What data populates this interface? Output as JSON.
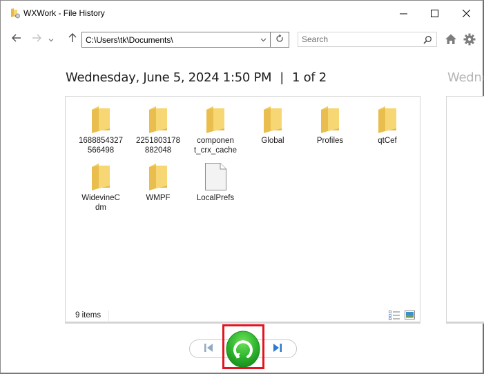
{
  "window": {
    "title": "WXWork - File History",
    "app_icon": "file-history-folder-icon",
    "controls": {
      "minimize": "minimize-icon",
      "maximize": "maximize-icon",
      "close": "close-icon"
    }
  },
  "nav": {
    "back": "back-arrow-icon",
    "forward": "forward-arrow-icon",
    "recent": "chevron-down-icon",
    "up": "up-arrow-icon",
    "address_value": "C:\\Users\\tk\\Documents\\",
    "refresh": "refresh-icon",
    "search_placeholder": "Search",
    "search_value": "",
    "home": "home-icon",
    "settings": "gear-icon"
  },
  "snapshot": {
    "date": "Wednesday, June 5, 2024 1:50 PM",
    "separator": "|",
    "position": "1 of 2",
    "next_date_partial": "Wednesday"
  },
  "files": [
    {
      "name": "1688854327566498",
      "label_lines": [
        "1688854327",
        "566498"
      ],
      "type": "folder"
    },
    {
      "name": "2251803178882048",
      "label_lines": [
        "2251803178",
        "882048"
      ],
      "type": "folder"
    },
    {
      "name": "component_crx_cache",
      "label_lines": [
        "componen",
        "t_crx_cache"
      ],
      "type": "folder"
    },
    {
      "name": "Global",
      "label_lines": [
        "Global"
      ],
      "type": "folder"
    },
    {
      "name": "Profiles",
      "label_lines": [
        "Profiles"
      ],
      "type": "folder"
    },
    {
      "name": "qtCef",
      "label_lines": [
        "qtCef"
      ],
      "type": "folder"
    },
    {
      "name": "WidevineCdm",
      "label_lines": [
        "WidevineC",
        "dm"
      ],
      "type": "folder"
    },
    {
      "name": "WMPF",
      "label_lines": [
        "WMPF"
      ],
      "type": "folder"
    },
    {
      "name": "LocalPrefs",
      "label_lines": [
        "LocalPrefs"
      ],
      "type": "file"
    }
  ],
  "status": {
    "item_count": "9 items",
    "view_details": "details-view-icon",
    "view_large_icons": "large-icons-view-icon"
  },
  "controls": {
    "previous": "previous-version-icon",
    "restore": "restore-icon",
    "next": "next-version-icon"
  },
  "colors": {
    "restore_green": "#2db52d",
    "highlight_red": "#e3141f",
    "nav_blue": "#2b79d0",
    "folder_yellow": "#f7d774"
  }
}
